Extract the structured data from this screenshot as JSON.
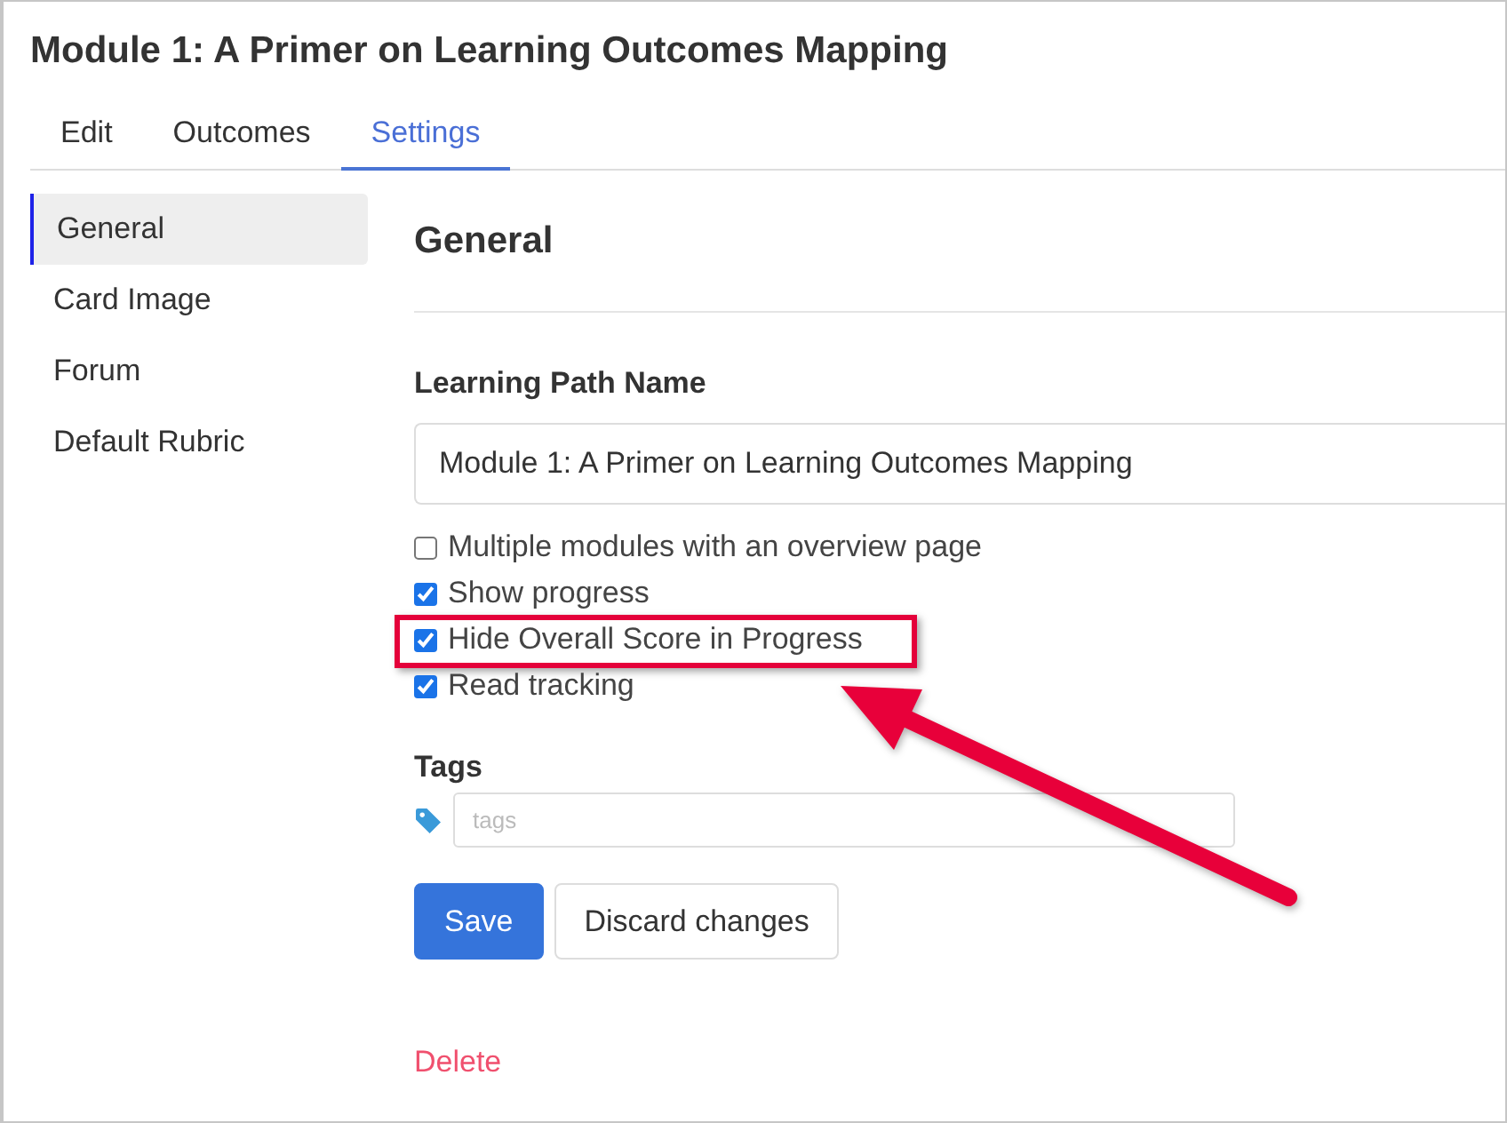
{
  "title": "Module 1: A Primer on Learning Outcomes Mapping",
  "tabs": [
    {
      "label": "Edit",
      "selected": false
    },
    {
      "label": "Outcomes",
      "selected": false
    },
    {
      "label": "Settings",
      "selected": true
    }
  ],
  "sidebar": {
    "items": [
      {
        "label": "General",
        "selected": true
      },
      {
        "label": "Card Image",
        "selected": false
      },
      {
        "label": "Forum",
        "selected": false
      },
      {
        "label": "Default Rubric",
        "selected": false
      }
    ]
  },
  "panel": {
    "heading": "General",
    "name_field": {
      "label": "Learning Path Name",
      "value": "Module 1: A Primer on Learning Outcomes Mapping"
    },
    "options": [
      {
        "label": "Multiple modules with an overview page",
        "checked": false,
        "highlighted": false
      },
      {
        "label": "Show progress",
        "checked": true,
        "highlighted": false
      },
      {
        "label": "Hide Overall Score in Progress",
        "checked": true,
        "highlighted": true
      },
      {
        "label": "Read tracking",
        "checked": true,
        "highlighted": false
      }
    ],
    "tags_field": {
      "label": "Tags",
      "placeholder": "tags"
    },
    "buttons": [
      {
        "label": "Save",
        "kind": "primary"
      },
      {
        "label": "Discard changes",
        "kind": "secondary"
      }
    ],
    "delete_link": "Delete"
  }
}
